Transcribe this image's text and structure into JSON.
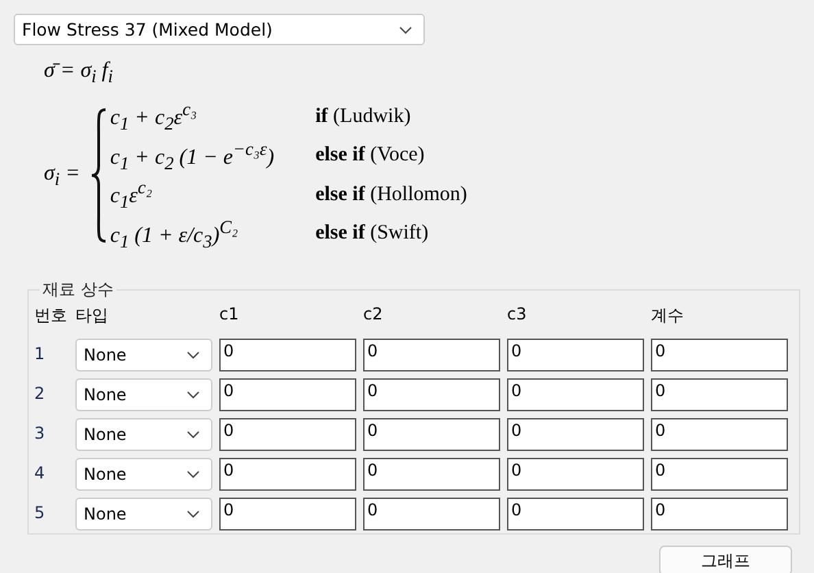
{
  "model_select": {
    "value": "Flow Stress 37 (Mixed Model)"
  },
  "formula": {
    "mean_stress": "σ̄ = σ$_{i}$ f$_{i}$",
    "lhs": "σ$_{i}$ =",
    "cases": [
      {
        "expression": "c$_{1}$ + c$_{2}$ε$^{c₃}$",
        "condition": "**if** (Ludwik)"
      },
      {
        "expression": "c$_{1}$ + c$_{2}$ (1 − e$^{−c₃ε}$)",
        "condition": "**else if** (Voce)"
      },
      {
        "expression": "c$_{1}$ε$^{c₂}$",
        "condition": "**else if** (Hollomon)"
      },
      {
        "expression": "c$_{1}$ (1 + ε/c$_{3}$)$^{C₂}$",
        "condition": "**else if** (Swift)"
      }
    ]
  },
  "constants": {
    "title": "재료 상수",
    "columns": [
      "번호",
      "타입",
      "c1",
      "c2",
      "c3",
      "계수"
    ],
    "rows": [
      {
        "number": "1",
        "type": "None",
        "c1": "0",
        "c2": "0",
        "c3": "0",
        "coefficient": "0"
      },
      {
        "number": "2",
        "type": "None",
        "c1": "0",
        "c2": "0",
        "c3": "0",
        "coefficient": "0"
      },
      {
        "number": "3",
        "type": "None",
        "c1": "0",
        "c2": "0",
        "c3": "0",
        "coefficient": "0"
      },
      {
        "number": "4",
        "type": "None",
        "c1": "0",
        "c2": "0",
        "c3": "0",
        "coefficient": "0"
      },
      {
        "number": "5",
        "type": "None",
        "c1": "0",
        "c2": "0",
        "c3": "0",
        "coefficient": "0"
      }
    ]
  },
  "graph_button": "그래프"
}
